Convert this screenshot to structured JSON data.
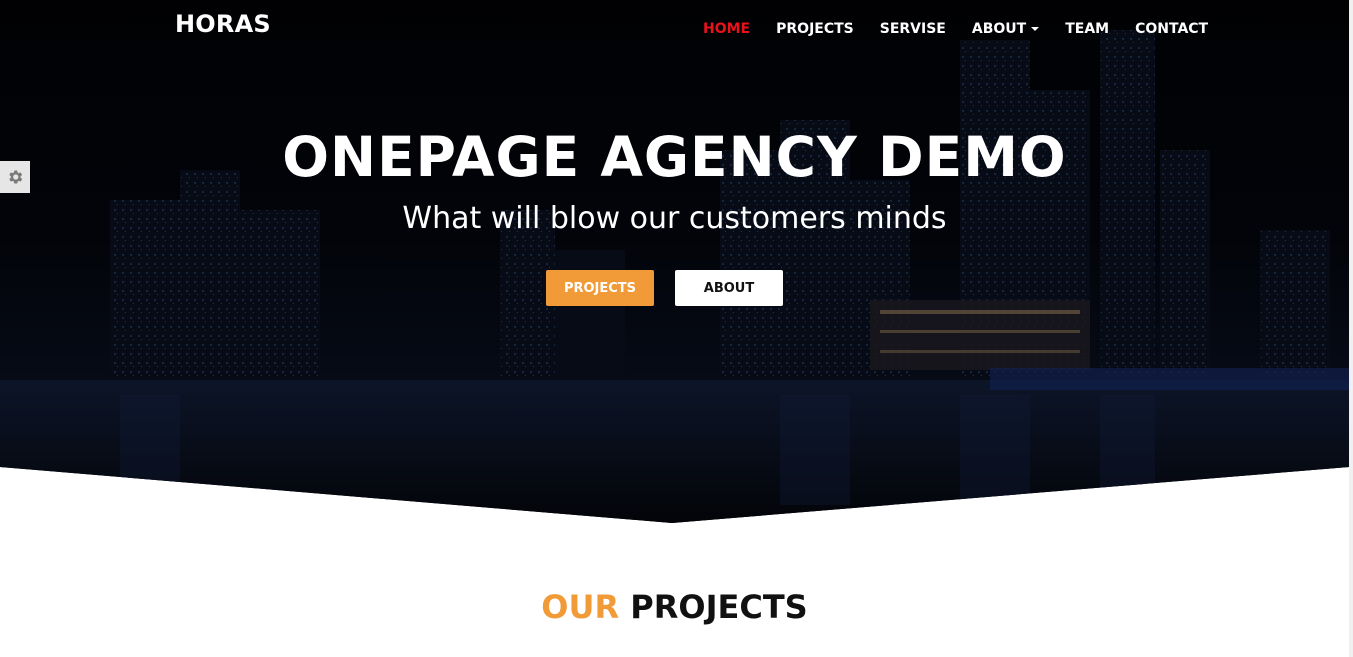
{
  "brand": "HORAS",
  "nav": {
    "items": [
      {
        "label": "HOME",
        "active": true
      },
      {
        "label": "PROJECTS"
      },
      {
        "label": "SERVISE"
      },
      {
        "label": "ABOUT",
        "dropdown": true
      },
      {
        "label": "TEAM"
      },
      {
        "label": "CONTACT"
      }
    ]
  },
  "hero": {
    "title": "ONEPAGE AGENCY DEMO",
    "subtitle": "What will blow our customers minds",
    "primary_button": "PROJECTS",
    "secondary_button": "ABOUT",
    "background": "night city skyline"
  },
  "section": {
    "title_accent": "OUR",
    "title_rest": "PROJECTS"
  },
  "colors": {
    "accent": "#f19b38",
    "nav_active": "#e8121a",
    "hero_dark": "#06070d",
    "text_dark": "#111111"
  },
  "icons": {
    "settings": "gear-icon",
    "dropdown": "caret-down-icon"
  }
}
